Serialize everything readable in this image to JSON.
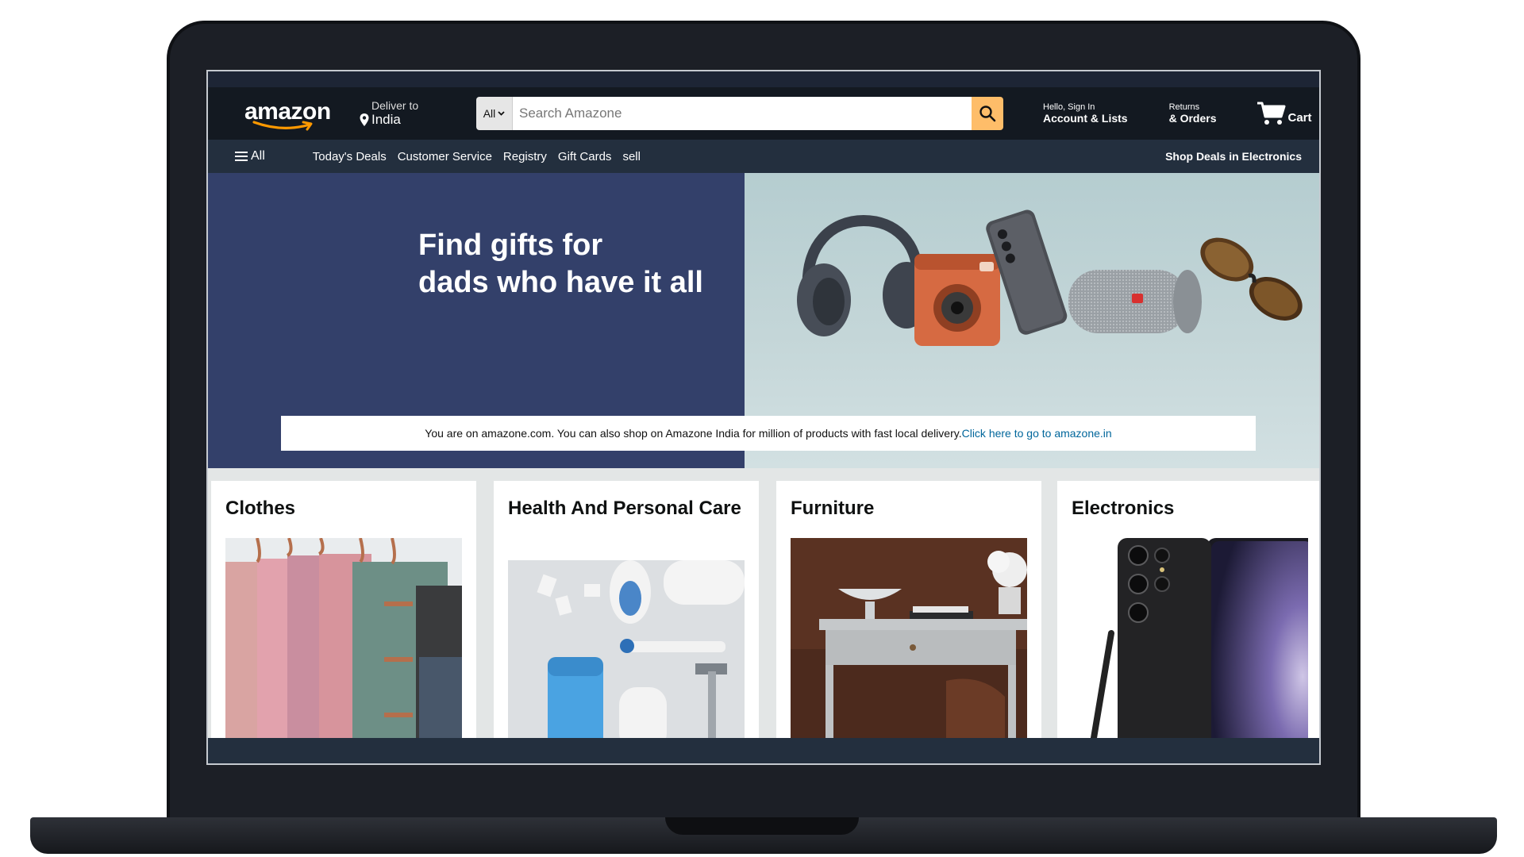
{
  "header": {
    "logo_text": "amazon",
    "deliver_label": "Deliver to",
    "deliver_location": "India",
    "search_category": "All",
    "search_placeholder": "Search Amazone",
    "account_greeting": "Hello, Sign In",
    "account_label": "Account & Lists",
    "returns_label": "Returns",
    "orders_label": "& Orders",
    "cart_label": "Cart"
  },
  "nav": {
    "all_label": "All",
    "links": [
      "Today's Deals",
      "Customer Service",
      "Registry",
      "Gift Cards",
      "sell"
    ],
    "right_label": "Shop Deals in Electronics"
  },
  "hero": {
    "title_line1": "Find gifts for",
    "title_line2": "dads who have it all",
    "notice_text": "You are on amazone.com. You can also shop on Amazone India for million of products with fast local delivery.",
    "notice_link": "Click here to go to amazone.in"
  },
  "cards": [
    {
      "title": "Clothes"
    },
    {
      "title": "Health And Personal Care"
    },
    {
      "title": "Furniture"
    },
    {
      "title": "Electronics"
    }
  ],
  "colors": {
    "header_bg": "#131921",
    "nav_bg": "#232f3e",
    "search_button": "#febd69",
    "hero_left_bg": "#33406a",
    "link": "#00669b"
  }
}
